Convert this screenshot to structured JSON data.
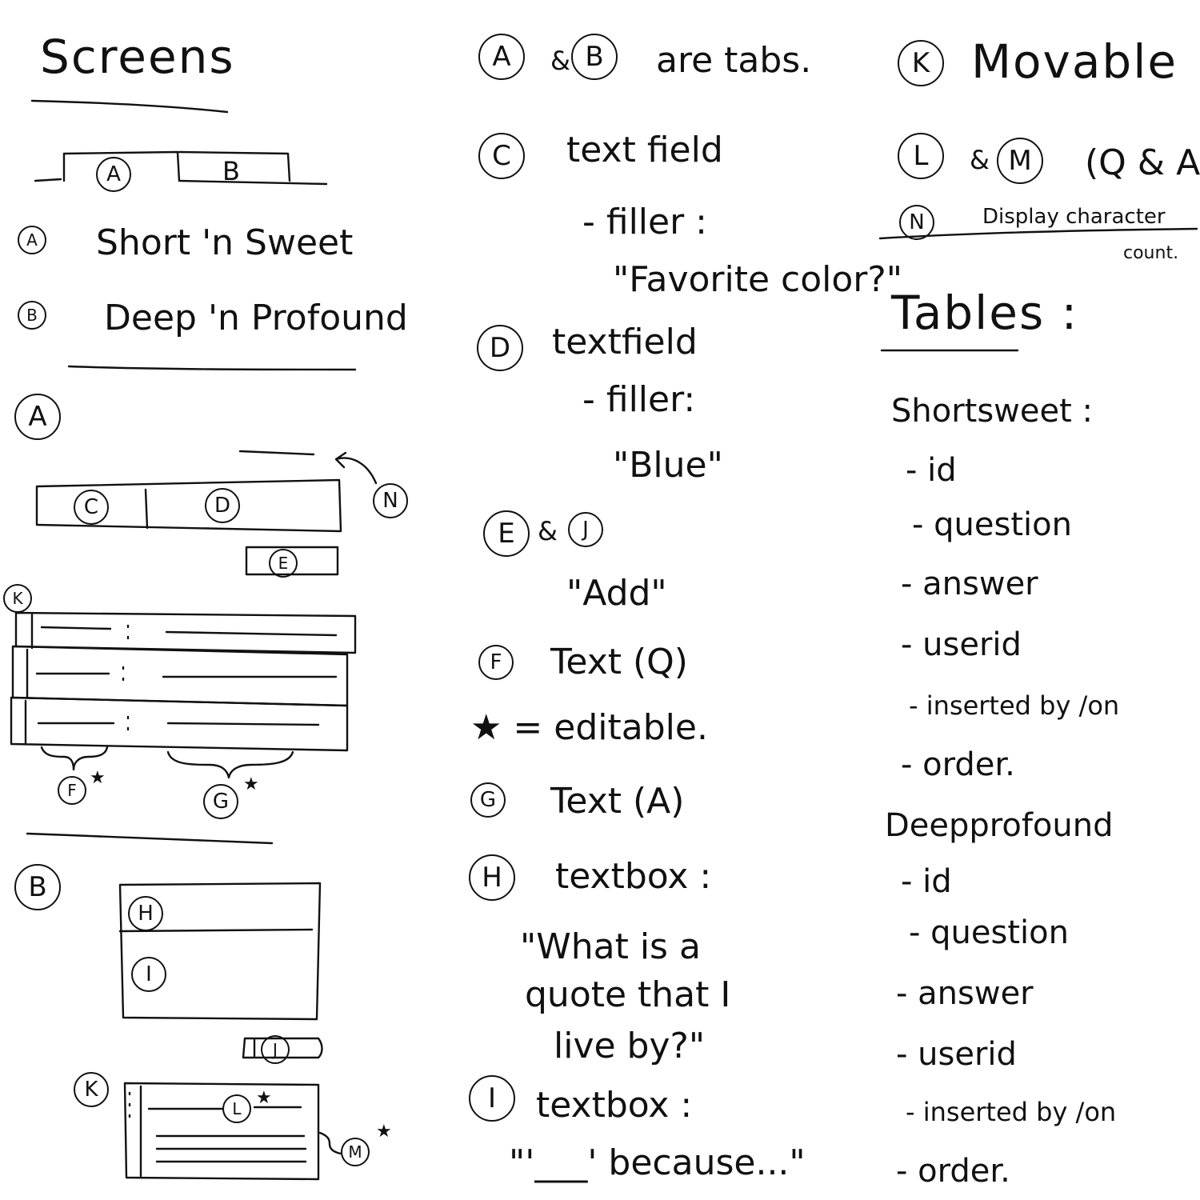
{
  "screens": {
    "heading": "Screens",
    "tab_a": "A",
    "tab_b": "B",
    "legend": [
      {
        "letter": "A",
        "text": "Short 'n Sweet"
      },
      {
        "letter": "B",
        "text": "Deep 'n Profound"
      }
    ],
    "screen_a": {
      "marker": "A",
      "c": "C",
      "d": "D",
      "n": "N",
      "e": "E",
      "k": "K",
      "f": "F",
      "g": "G"
    },
    "screen_b": {
      "marker": "B",
      "h": "H",
      "i": "I",
      "j": "J",
      "k": "K",
      "l": "L",
      "m": "M"
    },
    "star": "★"
  },
  "notes": {
    "tabs": {
      "a": "A",
      "amp": "&",
      "b": "B",
      "text": "are tabs."
    },
    "c": {
      "letter": "C",
      "text": "text field",
      "filler_label": "- filler :",
      "filler_value": "\"Favorite color?\""
    },
    "d": {
      "letter": "D",
      "text": "textfield",
      "filler_label": "- filler:",
      "filler_value": "\"Blue\""
    },
    "ej": {
      "e": "E",
      "amp": "&",
      "j": "J",
      "value": "\"Add\""
    },
    "f": {
      "letter": "F",
      "text": "Text (Q)"
    },
    "editable": "★ = editable.",
    "g": {
      "letter": "G",
      "text": "Text (A)"
    },
    "h": {
      "letter": "H",
      "text": "textbox :",
      "value_1": "\"What is a",
      "value_2": "quote that I",
      "value_3": "live by?\""
    },
    "i": {
      "letter": "I",
      "text": "textbox :",
      "value": "\"'___' because...\""
    }
  },
  "right": {
    "k": {
      "letter": "K",
      "text": "Movable"
    },
    "lm": {
      "l": "L",
      "amp": "&",
      "m": "M",
      "text": "(Q & A)"
    },
    "n": {
      "letter": "N",
      "text": "Display character",
      "text2": "count."
    },
    "tables_heading": "Tables :",
    "tables": [
      {
        "name": "Shortsweet :",
        "fields": [
          "- id",
          "- question",
          "- answer",
          "- userid",
          "- inserted by /on",
          "- order."
        ]
      },
      {
        "name": "Deepprofound",
        "fields": [
          "- id",
          "- question",
          "- answer",
          "- userid",
          "- inserted by /on",
          "- order."
        ]
      }
    ]
  }
}
